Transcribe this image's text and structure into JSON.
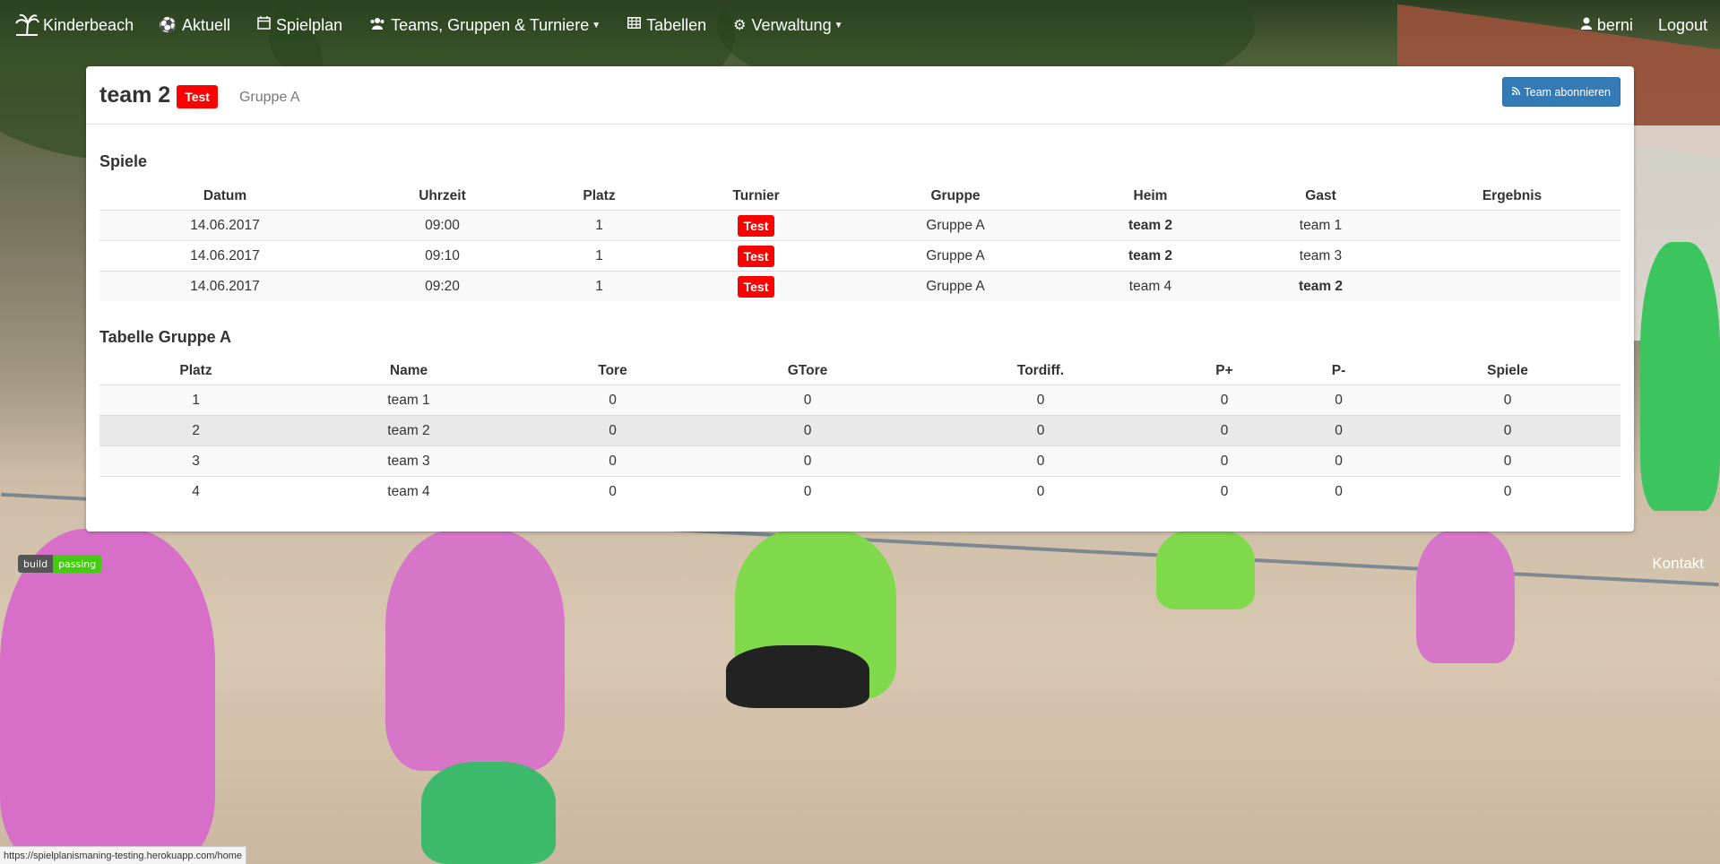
{
  "navbar": {
    "brand": "Kinderbeach",
    "items": [
      {
        "label": "Aktuell",
        "icon": "soccer-ball-icon",
        "glyph": "⚽"
      },
      {
        "label": "Spielplan",
        "icon": "calendar-icon",
        "glyph": "📅"
      },
      {
        "label": "Teams, Gruppen & Turniere",
        "icon": "users-icon",
        "glyph": "👥"
      },
      {
        "label": "Tabellen",
        "icon": "table-icon",
        "glyph": "▦"
      },
      {
        "label": "Verwaltung",
        "icon": "gears-icon",
        "glyph": "⚙"
      }
    ],
    "user": "berni",
    "logout": "Logout"
  },
  "header": {
    "title": "team 2",
    "badge": "Test",
    "group": "Gruppe A",
    "subscribe_button": "Team abonnieren"
  },
  "games": {
    "title": "Spiele",
    "columns": [
      "Datum",
      "Uhrzeit",
      "Platz",
      "Turnier",
      "Gruppe",
      "Heim",
      "Gast",
      "Ergebnis"
    ],
    "rows": [
      {
        "datum": "14.06.2017",
        "uhrzeit": "09:00",
        "platz": "1",
        "turnier": "Test",
        "gruppe": "Gruppe A",
        "heim": "team 2",
        "gast": "team 1",
        "ergebnis": ""
      },
      {
        "datum": "14.06.2017",
        "uhrzeit": "09:10",
        "platz": "1",
        "turnier": "Test",
        "gruppe": "Gruppe A",
        "heim": "team 2",
        "gast": "team 3",
        "ergebnis": ""
      },
      {
        "datum": "14.06.2017",
        "uhrzeit": "09:20",
        "platz": "1",
        "turnier": "Test",
        "gruppe": "Gruppe A",
        "heim": "team 4",
        "gast": "team 2",
        "ergebnis": ""
      }
    ]
  },
  "standings": {
    "title": "Tabelle Gruppe A",
    "columns": [
      "Platz",
      "Name",
      "Tore",
      "GTore",
      "Tordiff.",
      "P+",
      "P-",
      "Spiele"
    ],
    "rows": [
      {
        "platz": "1",
        "name": "team 1",
        "tore": "0",
        "gtore": "0",
        "tordiff": "0",
        "pplus": "0",
        "pminus": "0",
        "spiele": "0"
      },
      {
        "platz": "2",
        "name": "team 2",
        "tore": "0",
        "gtore": "0",
        "tordiff": "0",
        "pplus": "0",
        "pminus": "0",
        "spiele": "0"
      },
      {
        "platz": "3",
        "name": "team 3",
        "tore": "0",
        "gtore": "0",
        "tordiff": "0",
        "pplus": "0",
        "pminus": "0",
        "spiele": "0"
      },
      {
        "platz": "4",
        "name": "team 4",
        "tore": "0",
        "gtore": "0",
        "tordiff": "0",
        "pplus": "0",
        "pminus": "0",
        "spiele": "0"
      }
    ]
  },
  "footer": {
    "build_label": "build",
    "build_status": "passing",
    "kontakt": "Kontakt",
    "status_url": "https://spielplanismaning-testing.herokuapp.com/home"
  },
  "colors": {
    "accent": "#337ab7",
    "badge": "#ff0000",
    "build_passing": "#44cc11"
  }
}
